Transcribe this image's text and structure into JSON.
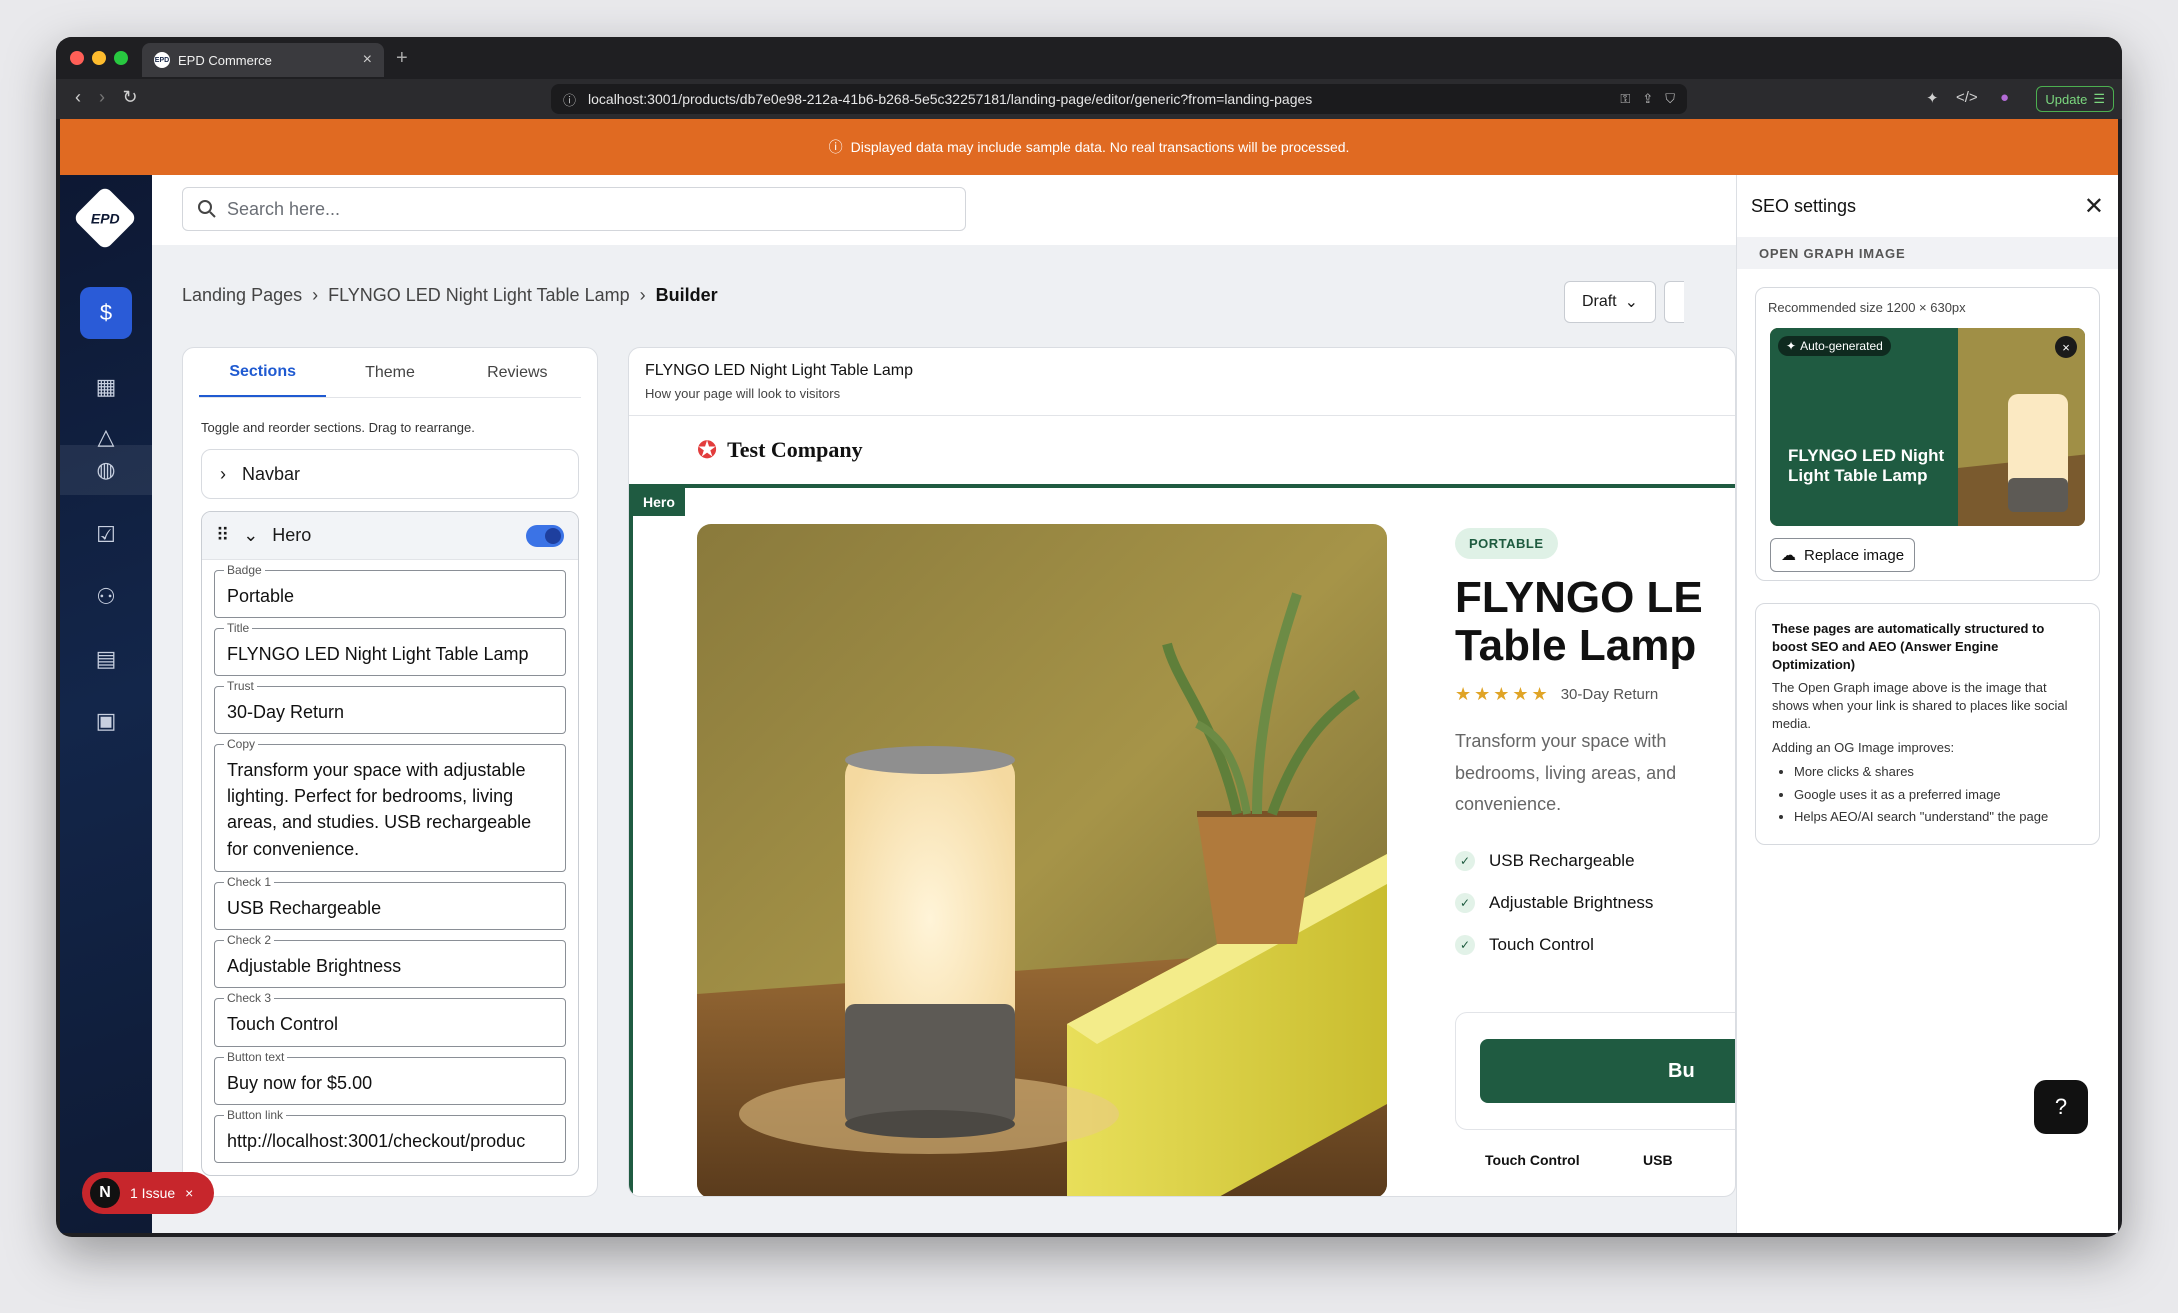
{
  "browser": {
    "tab_title": "EPD Commerce",
    "tab_favicon": "EPD",
    "url": "localhost:3001/products/db7e0e98-212a-41b6-b268-5e5c32257181/landing-page/editor/generic?from=landing-pages",
    "update_label": "Update"
  },
  "banner": {
    "text": "Displayed data may include sample data. No real transactions will be processed."
  },
  "search": {
    "placeholder": "Search here..."
  },
  "sidebar": {
    "logo": "EPD"
  },
  "breadcrumb": {
    "items": [
      "Landing Pages",
      "FLYNGO LED Night Light Table Lamp",
      "Builder"
    ]
  },
  "toolbar": {
    "status_label": "Draft"
  },
  "editor": {
    "tabs": [
      "Sections",
      "Theme",
      "Reviews"
    ],
    "hint": "Toggle and reorder sections. Drag to rearrange.",
    "navbar_label": "Navbar",
    "hero_label": "Hero",
    "hero_enabled": true,
    "fields": [
      {
        "label": "Badge",
        "value": "Portable"
      },
      {
        "label": "Title",
        "value": "FLYNGO LED Night Light Table Lamp"
      },
      {
        "label": "Trust",
        "value": "30-Day Return"
      },
      {
        "label": "Copy",
        "value": "Transform your space with adjustable lighting. Perfect for bedrooms, living areas, and studies. USB rechargeable for convenience."
      },
      {
        "label": "Check 1",
        "value": "USB Rechargeable"
      },
      {
        "label": "Check 2",
        "value": "Adjustable Brightness"
      },
      {
        "label": "Check 3",
        "value": "Touch Control"
      },
      {
        "label": "Button text",
        "value": "Buy now for $5.00"
      },
      {
        "label": "Button link",
        "value": "http://localhost:3001/checkout/produc"
      }
    ]
  },
  "preview": {
    "title": "FLYNGO LED Night Light Table Lamp",
    "subtitle": "How your page will look to visitors",
    "brand": "Test Company",
    "hero_tag": "Hero",
    "badge": "PORTABLE",
    "title_line1": "FLYNGO LE",
    "title_line2": "Table Lamp",
    "stars": "★★★★★",
    "trust": "30-Day Return",
    "copy_line1": "Transform your space with",
    "copy_line2": "bedrooms, living areas, and",
    "copy_line3": "convenience.",
    "checks": [
      "USB Rechargeable",
      "Adjustable Brightness",
      "Touch Control"
    ],
    "buy_label": "Bu",
    "features": [
      "Touch Control",
      "USB"
    ]
  },
  "seo": {
    "title": "SEO settings",
    "section": "OPEN GRAPH IMAGE",
    "recommended": "Recommended size 1200 × 630px",
    "auto_tag": "Auto-generated",
    "og_title": "FLYNGO LED Night Light Table Lamp",
    "replace_label": "Replace image",
    "info_title": "These pages are automatically structured to boost SEO and AEO (Answer Engine Optimization)",
    "info_p1": "The Open Graph image above is the image that shows when your link is shared to places like social media.",
    "info_p2": "Adding an OG Image improves:",
    "benefits": [
      "More clicks & shares",
      "Google uses it as a preferred image",
      "Helps AEO/AI search \"understand\" the page"
    ]
  },
  "issues": {
    "badge": "N",
    "label": "1 Issue"
  },
  "colors": {
    "accent": "#1f5b41",
    "banner": "#e06a22",
    "primary": "#1f5ad1"
  }
}
